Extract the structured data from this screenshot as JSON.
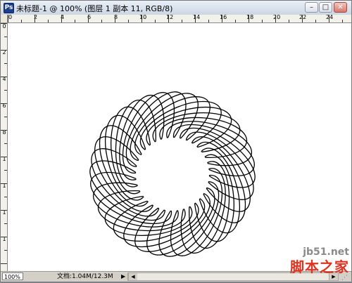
{
  "window": {
    "title": "未标题-1 @ 100% (图层 1 副本 11, RGB/8)",
    "app_icon": "photoshop-document-icon",
    "controls": {
      "minimize": "–",
      "maximize": "□",
      "close": "✕"
    }
  },
  "rulers": {
    "horizontal_labels": [
      "0",
      "2",
      "4",
      "6",
      "8",
      "10",
      "12",
      "14",
      "16",
      "18",
      "20",
      "22",
      "24"
    ],
    "vertical_labels": [
      "0",
      "2",
      "4",
      "6",
      "8",
      "1",
      "1",
      "1",
      "1"
    ]
  },
  "canvas": {
    "background": "#ffffff",
    "artwork": "spirograph-rosette-shape",
    "stroke_color": "#000000"
  },
  "status": {
    "zoom": "100%",
    "doc_info": "文档:1.04M/12.3M",
    "menu_arrow": "▶",
    "scroll_left": "◀",
    "scroll_right": "▶"
  },
  "watermark": {
    "site": "jb51.net",
    "name": "脚本之家"
  }
}
